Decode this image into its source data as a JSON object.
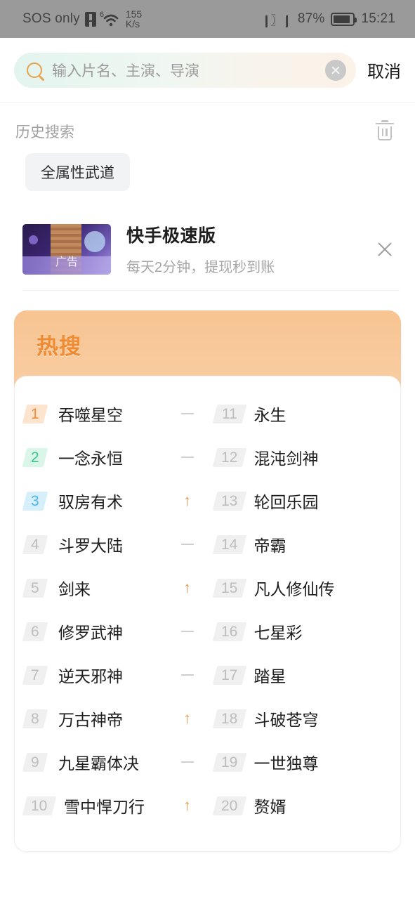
{
  "statusbar": {
    "carrier": "SOS only",
    "sim_icon": "sim-warning-icon",
    "wifi_icon": "wifi-icon",
    "wifi_superscript": "6",
    "net_speed_value": "155",
    "net_speed_unit": "K/s",
    "vibrate_icon": "vibrate-icon",
    "battery_percent": "87%",
    "battery_icon": "battery-icon",
    "time": "15:21"
  },
  "search": {
    "search_icon": "search-icon",
    "placeholder": "输入片名、主演、导演",
    "value": "",
    "clear_icon": "clear-circle-icon",
    "cancel_label": "取消"
  },
  "history": {
    "title": "历史搜索",
    "delete_icon": "trash-icon",
    "tags": [
      "全属性武道"
    ]
  },
  "ad": {
    "thumb_icon": "ad-thumbnail",
    "thumb_badge": "广告",
    "title": "快手极速版",
    "subtitle": "每天2分钟，提现秒到账",
    "close_icon": "close-icon"
  },
  "hot": {
    "title": "热搜",
    "left": [
      {
        "rank": "1",
        "name": "吞噬星空",
        "trend": "flat"
      },
      {
        "rank": "2",
        "name": "一念永恒",
        "trend": "flat"
      },
      {
        "rank": "3",
        "name": "驭房有术",
        "trend": "up"
      },
      {
        "rank": "4",
        "name": "斗罗大陆",
        "trend": "flat"
      },
      {
        "rank": "5",
        "name": "剑来",
        "trend": "up"
      },
      {
        "rank": "6",
        "name": "修罗武神",
        "trend": "flat"
      },
      {
        "rank": "7",
        "name": "逆天邪神",
        "trend": "flat"
      },
      {
        "rank": "8",
        "name": "万古神帝",
        "trend": "up"
      },
      {
        "rank": "9",
        "name": "九星霸体决",
        "trend": "flat"
      },
      {
        "rank": "10",
        "name": "雪中悍刀行",
        "trend": "up"
      }
    ],
    "right": [
      {
        "rank": "11",
        "name": "永生",
        "trend": "none"
      },
      {
        "rank": "12",
        "name": "混沌剑神",
        "trend": "none"
      },
      {
        "rank": "13",
        "name": "轮回乐园",
        "trend": "none"
      },
      {
        "rank": "14",
        "name": "帝霸",
        "trend": "none"
      },
      {
        "rank": "15",
        "name": "凡人修仙传",
        "trend": "none"
      },
      {
        "rank": "16",
        "name": "七星彩",
        "trend": "none"
      },
      {
        "rank": "17",
        "name": "踏星",
        "trend": "none"
      },
      {
        "rank": "18",
        "name": "斗破苍穹",
        "trend": "none"
      },
      {
        "rank": "19",
        "name": "一世独尊",
        "trend": "none"
      },
      {
        "rank": "20",
        "name": "赘婿",
        "trend": "none"
      }
    ],
    "trend_up_glyph": "↑"
  },
  "colors": {
    "accent_orange": "#ef8b33",
    "rank1": "#ef8b33",
    "rank2": "#3fc48c",
    "rank3": "#4fb6e8",
    "statusbar_bg": "#9a9a9a"
  }
}
